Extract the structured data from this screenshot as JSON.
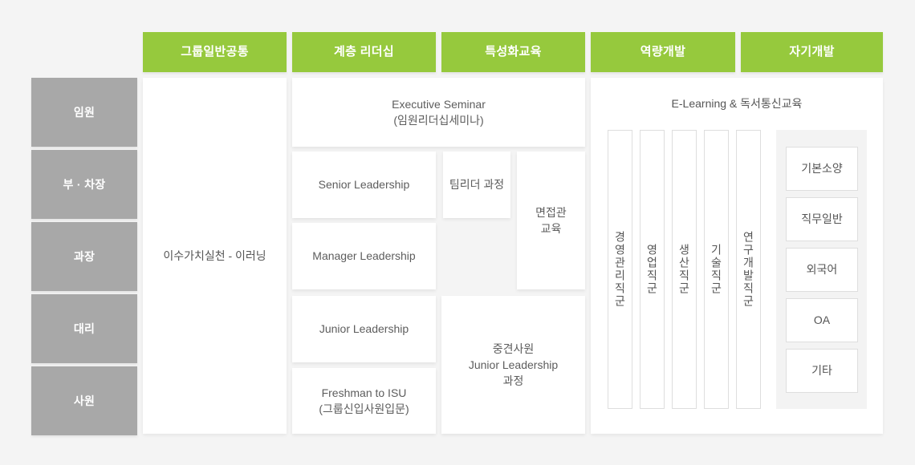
{
  "colors": {
    "accent_green": "#96c93d",
    "level_grey": "#a8a8a8",
    "page_background": "#f4f4f4",
    "panel_white": "#ffffff",
    "tray_grey": "#f3f3f3",
    "text_grey": "#555555"
  },
  "categories": [
    {
      "id": "group-common",
      "label": "그룹일반공통"
    },
    {
      "id": "tiered-leadership",
      "label": "계층 리더십"
    },
    {
      "id": "specialized",
      "label": "특성화교육"
    },
    {
      "id": "competency",
      "label": "역량개발"
    },
    {
      "id": "self-development",
      "label": "자기개발"
    }
  ],
  "levels": [
    {
      "id": "executive",
      "label": "임원"
    },
    {
      "id": "deputy",
      "label": "부 · 차장"
    },
    {
      "id": "manager",
      "label": "과장"
    },
    {
      "id": "assistant",
      "label": "대리"
    },
    {
      "id": "staff",
      "label": "사원"
    }
  ],
  "group_common": {
    "center_label": "이수가치실천 - 이러닝"
  },
  "tiered_leadership": {
    "executive_seminar": {
      "line1": "Executive Seminar",
      "line2": "(임원리더십세미나)"
    },
    "cards": [
      {
        "id": "senior-leadership",
        "label": "Senior Leadership"
      },
      {
        "id": "manager-leadership",
        "label": "Manager Leadership"
      },
      {
        "id": "junior-leadership",
        "label": "Junior Leadership"
      }
    ],
    "freshman": {
      "line1": "Freshman to ISU",
      "line2": "(그룹신입사원입문)"
    }
  },
  "specialized": {
    "team_leader": {
      "label": "팀리더 과정"
    },
    "interviewer": {
      "line1": "면접관",
      "line2": "교육"
    },
    "mid_level": {
      "line1": "중견사원",
      "line2": "Junior Leadership",
      "line3": "과정"
    }
  },
  "competency": {
    "panel_caption": "E-Learning & 독서통신교육",
    "job_families": [
      {
        "id": "management",
        "label": "경영관리직군"
      },
      {
        "id": "sales",
        "label": "영업직군"
      },
      {
        "id": "production",
        "label": "생산직군"
      },
      {
        "id": "technical",
        "label": "기술직군"
      },
      {
        "id": "rnd",
        "label": "연구개발직군"
      }
    ]
  },
  "self_development": {
    "chips": [
      {
        "id": "basic-literacy",
        "label": "기본소양"
      },
      {
        "id": "job-general",
        "label": "직무일반"
      },
      {
        "id": "foreign-lang",
        "label": "외국어"
      },
      {
        "id": "oa",
        "label": "OA"
      },
      {
        "id": "etc",
        "label": "기타"
      }
    ]
  }
}
